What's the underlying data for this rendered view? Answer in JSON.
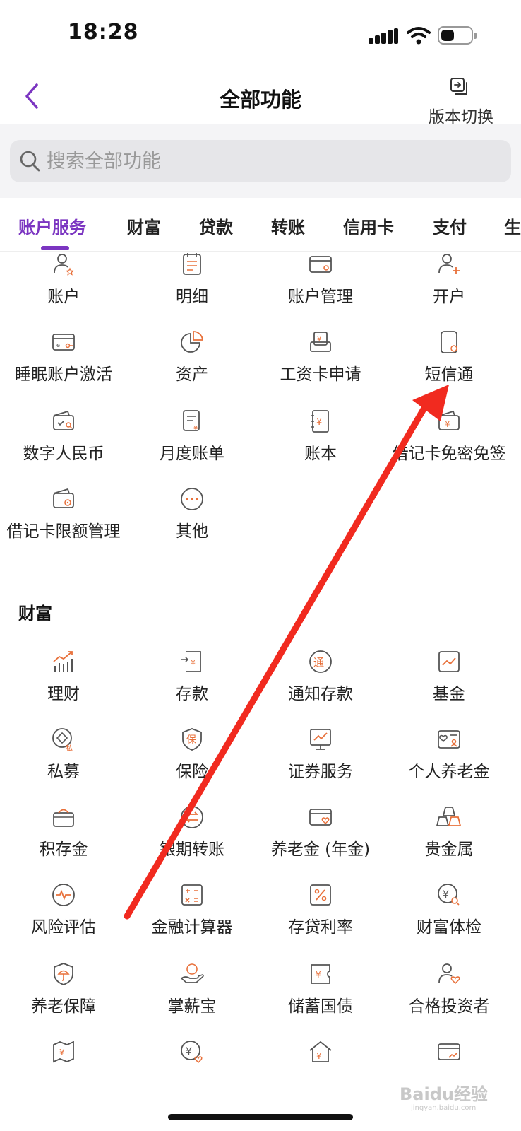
{
  "status_bar": {
    "time": "18:28"
  },
  "header": {
    "title": "全部功能",
    "switch_label": "版本切换"
  },
  "search": {
    "placeholder": "搜索全部功能"
  },
  "tabs": [
    {
      "label": "账户服务",
      "active": true
    },
    {
      "label": "财富"
    },
    {
      "label": "贷款"
    },
    {
      "label": "转账"
    },
    {
      "label": "信用卡"
    },
    {
      "label": "支付"
    },
    {
      "label": "生"
    }
  ],
  "account_items": [
    {
      "label": "账户",
      "icon": "account-icon"
    },
    {
      "label": "明细",
      "icon": "calendar-list-icon"
    },
    {
      "label": "账户管理",
      "icon": "card-manage-icon"
    },
    {
      "label": "开户",
      "icon": "add-user-icon"
    },
    {
      "label": "睡眠账户激活",
      "icon": "card-key-icon"
    },
    {
      "label": "资产",
      "icon": "pie-chart-icon"
    },
    {
      "label": "工资卡申请",
      "icon": "salary-card-icon"
    },
    {
      "label": "短信通",
      "icon": "phone-message-icon"
    },
    {
      "label": "数字人民币",
      "icon": "wallet-search-icon"
    },
    {
      "label": "月度账单",
      "icon": "bill-yuan-icon"
    },
    {
      "label": "账本",
      "icon": "ledger-yuan-icon"
    },
    {
      "label": "借记卡免密免签",
      "icon": "wallet-yuan-icon"
    },
    {
      "label": "借记卡限额管理",
      "icon": "wallet-gear-icon"
    },
    {
      "label": "其他",
      "icon": "more-dots-icon"
    }
  ],
  "wealth_section": {
    "title": "财富"
  },
  "wealth_items": [
    {
      "label": "理财",
      "icon": "bar-trend-icon"
    },
    {
      "label": "存款",
      "icon": "deposit-icon"
    },
    {
      "label": "通知存款",
      "icon": "notice-deposit-icon"
    },
    {
      "label": "基金",
      "icon": "fund-chart-icon"
    },
    {
      "label": "私募",
      "icon": "private-fund-icon"
    },
    {
      "label": "保险",
      "icon": "insurance-shield-icon"
    },
    {
      "label": "证券服务",
      "icon": "securities-monitor-icon"
    },
    {
      "label": "个人养老金",
      "icon": "pension-card-icon"
    },
    {
      "label": "积存金",
      "icon": "gold-save-icon"
    },
    {
      "label": "银期转账",
      "icon": "transfer-icon"
    },
    {
      "label": "养老金 (年金)",
      "icon": "annuity-card-icon"
    },
    {
      "label": "贵金属",
      "icon": "gold-bars-icon"
    },
    {
      "label": "风险评估",
      "icon": "risk-pulse-icon"
    },
    {
      "label": "金融计算器",
      "icon": "calculator-icon"
    },
    {
      "label": "存贷利率",
      "icon": "percent-icon"
    },
    {
      "label": "财富体检",
      "icon": "wealth-check-icon"
    },
    {
      "label": "养老保障",
      "icon": "umbrella-shield-icon"
    },
    {
      "label": "掌薪宝",
      "icon": "hand-coin-icon"
    },
    {
      "label": "储蓄国债",
      "icon": "bond-ticket-icon"
    },
    {
      "label": "合格投资者",
      "icon": "investor-icon"
    },
    {
      "label": "",
      "icon": "map-yuan-icon"
    },
    {
      "label": "",
      "icon": "coin-heart-icon"
    },
    {
      "label": "",
      "icon": "house-yuan-icon"
    },
    {
      "label": "",
      "icon": "card-trend-icon"
    }
  ],
  "watermark": {
    "text": "Baidu经验",
    "sub": "jingyan.baidu.com"
  },
  "colors": {
    "accent": "#7b35c1",
    "icon_orange": "#e8703a",
    "icon_gray": "#555555"
  }
}
